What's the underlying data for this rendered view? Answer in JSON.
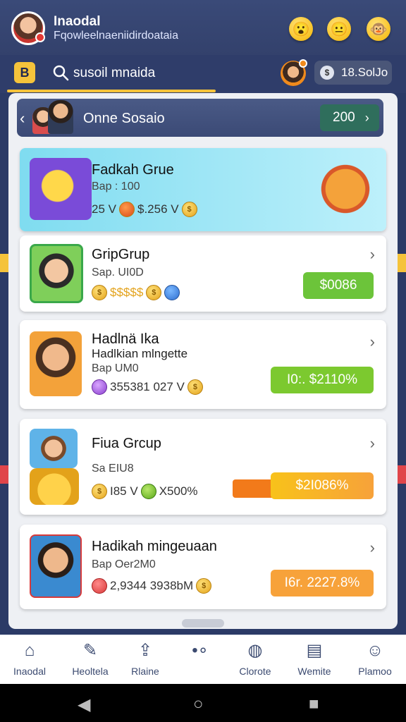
{
  "header": {
    "title": "Inaodal",
    "subtitle": "Fqowleelnaeniidirdoataia",
    "emojis": [
      "😮",
      "😐",
      "🐵"
    ]
  },
  "search": {
    "logo": "B",
    "query": "susoil mnaida",
    "balance": "18.SolJo"
  },
  "group_header": {
    "title": "Onne Sosaio",
    "count": "200"
  },
  "cards": [
    {
      "name": "Fadkah Grue",
      "meta": "Bap : 100",
      "stats": "25 V",
      "stats2": "$.256 V"
    },
    {
      "name": "GripGrup",
      "meta": "Sap. UI0D",
      "stats": "$$$$$",
      "reward": "$0086"
    },
    {
      "name": "Hadlnä Ika",
      "sub": "Hadlkian mlngette",
      "meta": "Bap UM0",
      "stats": "355381 027 V",
      "reward": "I0:. $2110%"
    },
    {
      "name": "Fiua Grcup",
      "meta": "Sa EIU8",
      "stats": "I85 V",
      "stats2": "X500%",
      "reward": "$2I086%"
    },
    {
      "name": "Hadikah mingeuaan",
      "meta": "Bap Oer2M0",
      "stats": "2,9344 3938bM",
      "reward": "I6r. 2227.8%"
    }
  ],
  "nav": [
    {
      "label": "Inaodal",
      "icon": "home-icon"
    },
    {
      "label": "Heoltela",
      "icon": "edit-icon"
    },
    {
      "label": "Rlaine",
      "icon": "share-icon"
    },
    {
      "label": "",
      "icon": "group-dots-icon"
    },
    {
      "label": "Clorote",
      "icon": "globe-icon"
    },
    {
      "label": "Wemite",
      "icon": "calendar-icon"
    },
    {
      "label": "Plamoo",
      "icon": "person-icon"
    }
  ],
  "colors": {
    "header_bg": "#33416c",
    "accent_yellow": "#f5c33b",
    "reward_green": "#7cc92f",
    "reward_orange": "#f7a23a"
  }
}
